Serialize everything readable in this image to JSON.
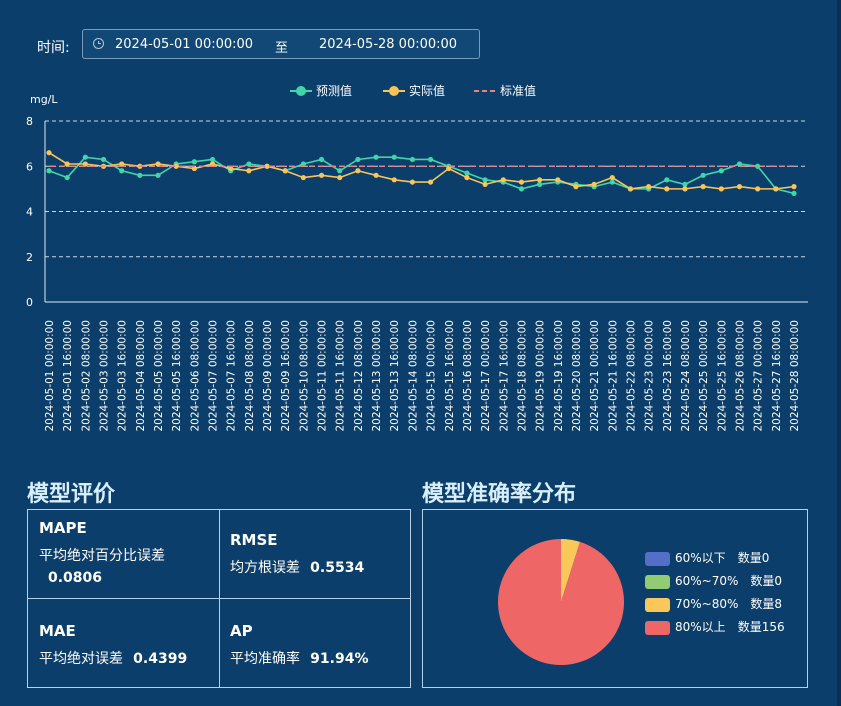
{
  "filter": {
    "time_label": "时间:",
    "start": "2024-05-01 00:00:00",
    "separator": "至",
    "end": "2024-05-28 00:00:00"
  },
  "chart_data": {
    "type": "line",
    "unit": "mg/L",
    "ylim": [
      0,
      8
    ],
    "yticks": [
      0,
      2,
      4,
      6,
      8
    ],
    "grid": true,
    "legend_position": "top-center",
    "categories": [
      "2024-05-01 00:00:00",
      "2024-05-01 16:00:00",
      "2024-05-02 08:00:00",
      "2024-05-03 00:00:00",
      "2024-05-03 16:00:00",
      "2024-05-04 08:00:00",
      "2024-05-05 00:00:00",
      "2024-05-05 16:00:00",
      "2024-05-06 08:00:00",
      "2024-05-07 00:00:00",
      "2024-05-07 16:00:00",
      "2024-05-08 08:00:00",
      "2024-05-09 00:00:00",
      "2024-05-09 16:00:00",
      "2024-05-10 08:00:00",
      "2024-05-11 00:00:00",
      "2024-05-11 16:00:00",
      "2024-05-12 08:00:00",
      "2024-05-13 00:00:00",
      "2024-05-13 16:00:00",
      "2024-05-14 08:00:00",
      "2024-05-15 00:00:00",
      "2024-05-15 16:00:00",
      "2024-05-16 08:00:00",
      "2024-05-17 00:00:00",
      "2024-05-17 16:00:00",
      "2024-05-18 08:00:00",
      "2024-05-19 00:00:00",
      "2024-05-19 16:00:00",
      "2024-05-20 08:00:00",
      "2024-05-21 00:00:00",
      "2024-05-21 16:00:00",
      "2024-05-22 08:00:00",
      "2024-05-23 00:00:00",
      "2024-05-23 16:00:00",
      "2024-05-24 08:00:00",
      "2024-05-25 00:00:00",
      "2024-05-25 16:00:00",
      "2024-05-26 08:00:00",
      "2024-05-27 00:00:00",
      "2024-05-27 16:00:00",
      "2024-05-28 08:00:00"
    ],
    "series": [
      {
        "name": "预测值",
        "color": "#3fd6a8",
        "values": [
          5.8,
          5.5,
          6.4,
          6.3,
          5.8,
          5.6,
          5.6,
          6.1,
          6.2,
          6.3,
          5.8,
          6.1,
          6.0,
          5.8,
          6.1,
          6.3,
          5.8,
          6.3,
          6.4,
          6.4,
          6.3,
          6.3,
          6.0,
          5.7,
          5.4,
          5.3,
          5.0,
          5.2,
          5.3,
          5.2,
          5.1,
          5.3,
          5.0,
          5.0,
          5.4,
          5.2,
          5.6,
          5.8,
          6.1,
          6.0,
          5.0,
          4.8
        ]
      },
      {
        "name": "实际值",
        "color": "#f9c556",
        "values": [
          6.6,
          6.1,
          6.1,
          6.0,
          6.1,
          6.0,
          6.1,
          6.0,
          5.9,
          6.1,
          5.9,
          5.8,
          6.0,
          5.8,
          5.5,
          5.6,
          5.5,
          5.8,
          5.6,
          5.4,
          5.3,
          5.3,
          5.9,
          5.5,
          5.2,
          5.4,
          5.3,
          5.4,
          5.4,
          5.1,
          5.2,
          5.5,
          5.0,
          5.1,
          5.0,
          5.0,
          5.1,
          5.0,
          5.1,
          5.0,
          5.0,
          5.1
        ]
      },
      {
        "name": "标准值",
        "color": "#ee7f7f",
        "dashed": true,
        "values": [
          6,
          6,
          6,
          6,
          6,
          6,
          6,
          6,
          6,
          6,
          6,
          6,
          6,
          6,
          6,
          6,
          6,
          6,
          6,
          6,
          6,
          6,
          6,
          6,
          6,
          6,
          6,
          6,
          6,
          6,
          6,
          6,
          6,
          6,
          6,
          6,
          6,
          6,
          6,
          6,
          6,
          6
        ]
      }
    ]
  },
  "evaluation": {
    "title": "模型评价",
    "mape": {
      "abbr": "MAPE",
      "desc": "平均绝对百分比误差",
      "value": "0.0806"
    },
    "rmse": {
      "abbr": "RMSE",
      "desc": "均方根误差",
      "value": "0.5534"
    },
    "mae": {
      "abbr": "MAE",
      "desc": "平均绝对误差",
      "value": "0.4399"
    },
    "ap": {
      "abbr": "AP",
      "desc": "平均准确率",
      "value": "91.94%"
    }
  },
  "accuracy": {
    "title": "模型准确率分布",
    "chart_data": {
      "type": "pie",
      "slices": [
        {
          "label": "60%以下",
          "count_label": "数量0",
          "value": 0,
          "color": "#5470c6"
        },
        {
          "label": "60%~70%",
          "count_label": "数量0",
          "value": 0,
          "color": "#91cc75"
        },
        {
          "label": "70%~80%",
          "count_label": "数量8",
          "value": 8,
          "color": "#fac858"
        },
        {
          "label": "80%以上",
          "count_label": "数量156",
          "value": 156,
          "color": "#ee6666"
        }
      ]
    }
  }
}
